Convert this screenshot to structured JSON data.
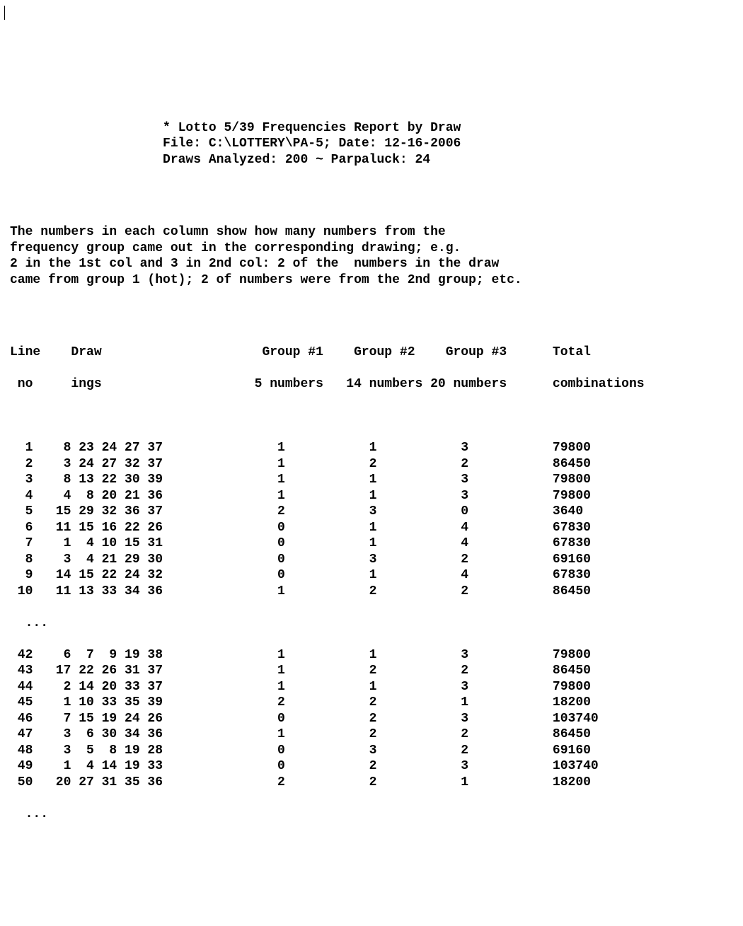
{
  "header": {
    "line1": "* Lotto 5/39 Frequencies Report by Draw",
    "line2": "File: C:\\LOTTERY\\PA-5; Date: 12-16-2006",
    "line3": "Draws Analyzed: 200 ~ Parpaluck: 24"
  },
  "intro": {
    "l1": "The numbers in each column show how many numbers from the",
    "l2": "frequency group came out in the corresponding drawing; e.g.",
    "l3": "2 in the 1st col and 3 in 2nd col: 2 of the  numbers in the draw",
    "l4": "came from group 1 (hot); 2 of numbers were from the 2nd group; etc."
  },
  "columns": {
    "h1a": "Line",
    "h1b": "Draw",
    "h1c": "Group #1",
    "h1d": "Group #2",
    "h1e": "Group #3",
    "h1f": "Total",
    "h2a": " no ",
    "h2b": "ings",
    "h2c": "5 numbers",
    "h2d": "14 numbers",
    "h2e": "20 numbers",
    "h2f": "combinations"
  },
  "ellipsis": "...",
  "rows1": [
    {
      "line": "1",
      "draw": " 8 23 24 27 37",
      "g1": "1",
      "g2": "1",
      "g3": "3",
      "total": "79800"
    },
    {
      "line": "2",
      "draw": " 3 24 27 32 37",
      "g1": "1",
      "g2": "2",
      "g3": "2",
      "total": "86450"
    },
    {
      "line": "3",
      "draw": " 8 13 22 30 39",
      "g1": "1",
      "g2": "1",
      "g3": "3",
      "total": "79800"
    },
    {
      "line": "4",
      "draw": " 4  8 20 21 36",
      "g1": "1",
      "g2": "1",
      "g3": "3",
      "total": "79800"
    },
    {
      "line": "5",
      "draw": "15 29 32 36 37",
      "g1": "2",
      "g2": "3",
      "g3": "0",
      "total": "3640"
    },
    {
      "line": "6",
      "draw": "11 15 16 22 26",
      "g1": "0",
      "g2": "1",
      "g3": "4",
      "total": "67830"
    },
    {
      "line": "7",
      "draw": " 1  4 10 15 31",
      "g1": "0",
      "g2": "1",
      "g3": "4",
      "total": "67830"
    },
    {
      "line": "8",
      "draw": " 3  4 21 29 30",
      "g1": "0",
      "g2": "3",
      "g3": "2",
      "total": "69160"
    },
    {
      "line": "9",
      "draw": "14 15 22 24 32",
      "g1": "0",
      "g2": "1",
      "g3": "4",
      "total": "67830"
    },
    {
      "line": "10",
      "draw": "11 13 33 34 36",
      "g1": "1",
      "g2": "2",
      "g3": "2",
      "total": "86450"
    }
  ],
  "rows2": [
    {
      "line": "42",
      "draw": " 6  7  9 19 38",
      "g1": "1",
      "g2": "1",
      "g3": "3",
      "total": "79800"
    },
    {
      "line": "43",
      "draw": "17 22 26 31 37",
      "g1": "1",
      "g2": "2",
      "g3": "2",
      "total": "86450"
    },
    {
      "line": "44",
      "draw": " 2 14 20 33 37",
      "g1": "1",
      "g2": "1",
      "g3": "3",
      "total": "79800"
    },
    {
      "line": "45",
      "draw": " 1 10 33 35 39",
      "g1": "2",
      "g2": "2",
      "g3": "1",
      "total": "18200"
    },
    {
      "line": "46",
      "draw": " 7 15 19 24 26",
      "g1": "0",
      "g2": "2",
      "g3": "3",
      "total": "103740"
    },
    {
      "line": "47",
      "draw": " 3  6 30 34 36",
      "g1": "1",
      "g2": "2",
      "g3": "2",
      "total": "86450"
    },
    {
      "line": "48",
      "draw": " 3  5  8 19 28",
      "g1": "0",
      "g2": "3",
      "g3": "2",
      "total": "69160"
    },
    {
      "line": "49",
      "draw": " 1  4 14 19 33",
      "g1": "0",
      "g2": "2",
      "g3": "3",
      "total": "103740"
    },
    {
      "line": "50",
      "draw": "20 27 31 35 36",
      "g1": "2",
      "g2": "2",
      "g3": "1",
      "total": "18200"
    }
  ]
}
